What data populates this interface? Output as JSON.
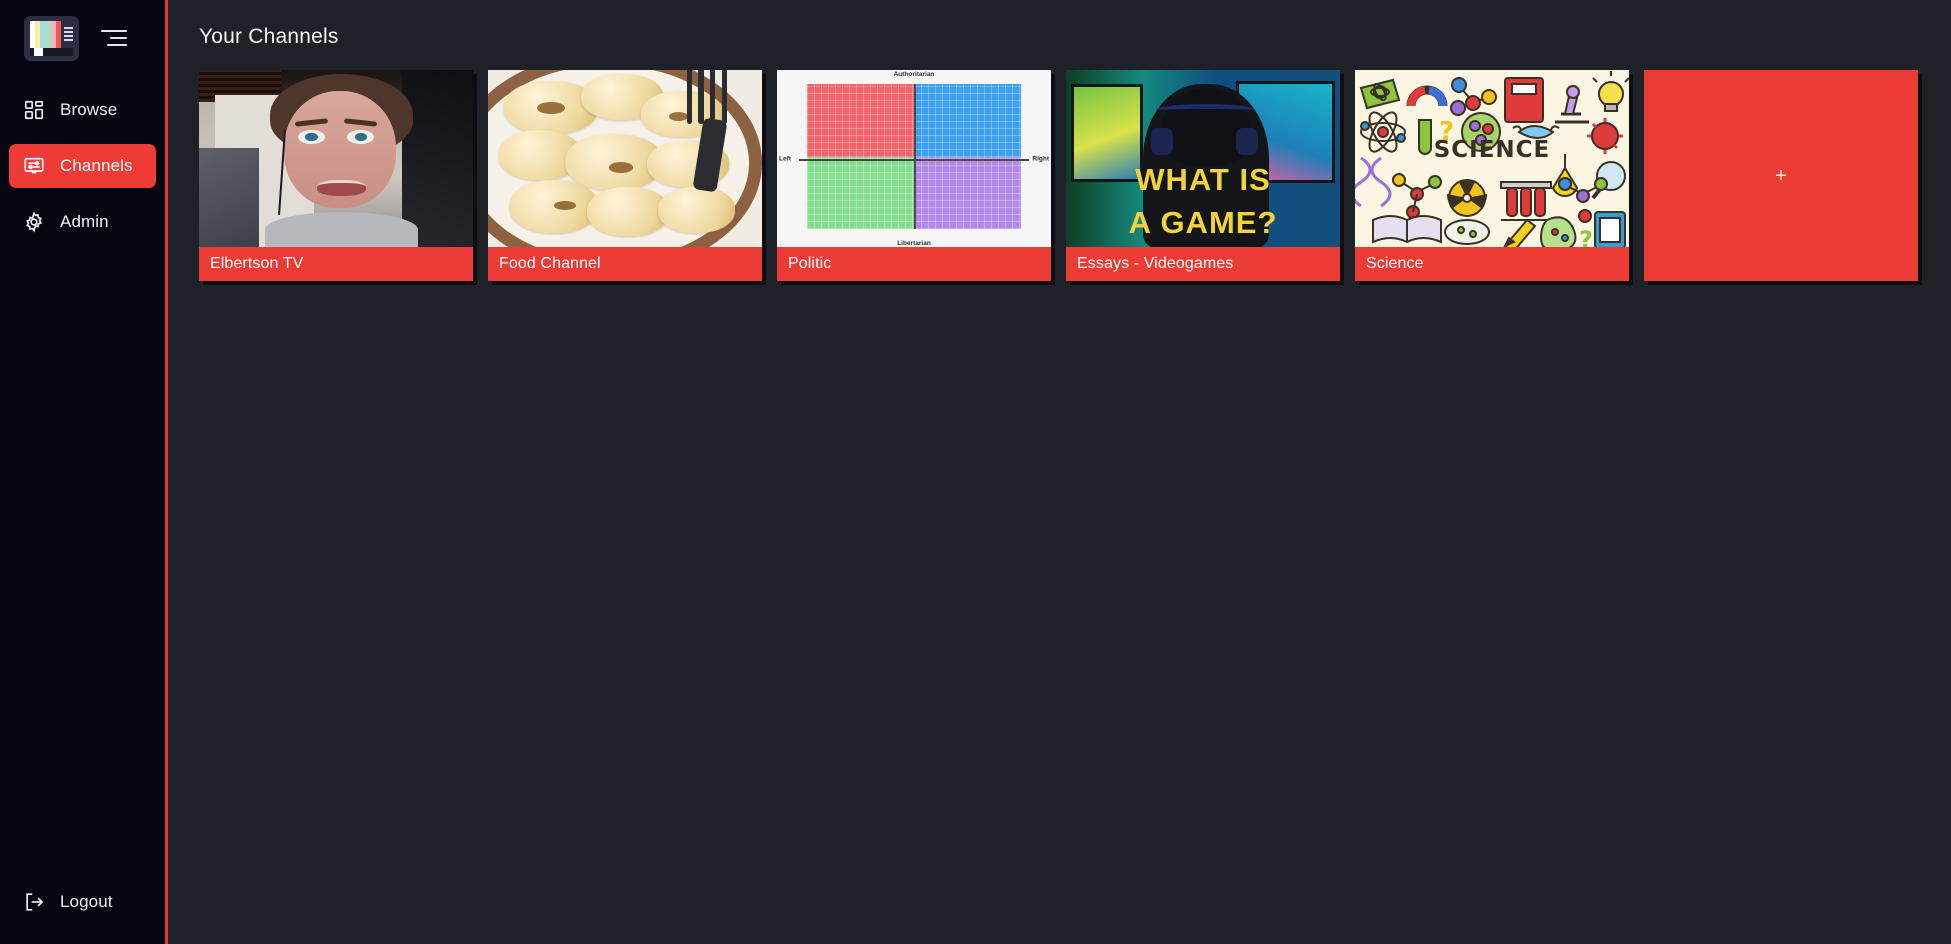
{
  "colors": {
    "accent_red": "#ea3b34",
    "sidebar_bg": "#05060f",
    "main_bg": "#1f2129",
    "card_bg": "#0b0c14",
    "text": "#eef0f6"
  },
  "sidebar": {
    "logo_name": "tv-test-pattern-logo",
    "menu_toggle_name": "hamburger-menu-icon",
    "items": [
      {
        "label": "Browse",
        "icon": "grid-layout-icon",
        "active": false
      },
      {
        "label": "Channels",
        "icon": "channel-screen-icon",
        "active": true
      },
      {
        "label": "Admin",
        "icon": "gear-icon",
        "active": false
      }
    ],
    "logout": {
      "label": "Logout",
      "icon": "logout-arrow-icon"
    }
  },
  "main": {
    "page_title": "Your Channels",
    "add_card": {
      "symbol": "+",
      "aria_label": "Add channel"
    },
    "channels": [
      {
        "label": "Elbertson TV",
        "thumb": "webcam-portrait"
      },
      {
        "label": "Food Channel",
        "thumb": "potato-gratin-plate"
      },
      {
        "label": "Politic",
        "thumb": "political-compass"
      },
      {
        "label": "Essays - Videogames",
        "thumb": "gamer-what-is-a-game"
      },
      {
        "label": "Science",
        "thumb": "science-doodles"
      }
    ]
  },
  "thumbnails": {
    "political_compass": {
      "top_label": "Authoritarian",
      "bottom_label": "Libertarian",
      "left_label": "Left",
      "right_label": "Right",
      "quadrants": [
        {
          "position": "top-left",
          "color": "#f2646c"
        },
        {
          "position": "top-right",
          "color": "#3ba1ee"
        },
        {
          "position": "bottom-left",
          "color": "#86dd90"
        },
        {
          "position": "bottom-right",
          "color": "#b38ae8"
        }
      ]
    },
    "videogames": {
      "line1": "WHAT IS",
      "line2": "A GAME?"
    },
    "science": {
      "word": "SCIENCE"
    }
  }
}
